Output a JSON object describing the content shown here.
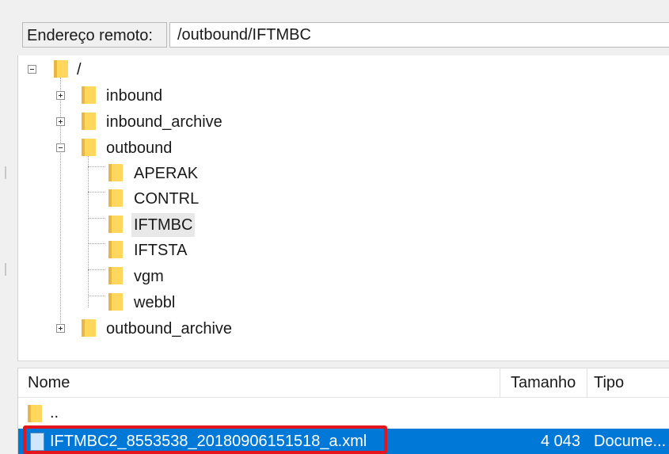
{
  "address_bar": {
    "label": "Endereço remoto:",
    "value": "/outbound/IFTMBC"
  },
  "tree": {
    "root": "/",
    "items": [
      {
        "label": "inbound",
        "expander": "plus"
      },
      {
        "label": "inbound_archive",
        "expander": "plus"
      },
      {
        "label": "outbound",
        "expander": "minus"
      },
      {
        "label": "APERAK"
      },
      {
        "label": "CONTRL"
      },
      {
        "label": "IFTMBC",
        "selected": true
      },
      {
        "label": "IFTSTA"
      },
      {
        "label": "vgm"
      },
      {
        "label": "webbl"
      },
      {
        "label": "outbound_archive",
        "expander": "plus"
      }
    ]
  },
  "file_list": {
    "columns": [
      "Nome",
      "Tamanho",
      "Tipo"
    ],
    "rows": [
      {
        "name": "..",
        "size": "",
        "type": ""
      },
      {
        "name": "IFTMBC2_8553538_20180906151518_a.xml",
        "size": "4 043",
        "type": "Docume..."
      }
    ],
    "selected_row": 1
  },
  "colors": {
    "selection": "#0078d7",
    "folder": "#ffd75c",
    "highlight_box": "#e6141b"
  }
}
